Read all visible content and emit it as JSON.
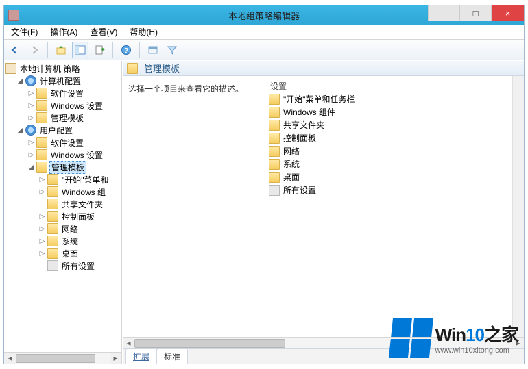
{
  "window": {
    "title": "本地组策略编辑器",
    "minimize": "–",
    "maximize": "□",
    "close": "×"
  },
  "menu": {
    "file": "文件(F)",
    "action": "操作(A)",
    "view": "查看(V)",
    "help": "帮助(H)"
  },
  "tree": {
    "root": "本地计算机 策略",
    "computer_config": "计算机配置",
    "cc_software": "软件设置",
    "cc_windows": "Windows 设置",
    "cc_admin": "管理模板",
    "user_config": "用户配置",
    "uc_software": "软件设置",
    "uc_windows": "Windows 设置",
    "uc_admin": "管理模板",
    "start_menu": "\"开始\"菜单和",
    "win_comp": "Windows 组",
    "shared": "共享文件夹",
    "control_panel": "控制面板",
    "network": "网络",
    "system": "系统",
    "desktop": "桌面",
    "all_settings": "所有设置"
  },
  "right": {
    "header": "管理模板",
    "desc": "选择一个项目来查看它的描述。",
    "col_setting": "设置",
    "items": {
      "start_menu": "\"开始\"菜单和任务栏",
      "win_comp": "Windows 组件",
      "shared": "共享文件夹",
      "control_panel": "控制面板",
      "network": "网络",
      "system": "系统",
      "desktop": "桌面",
      "all_settings": "所有设置"
    },
    "tab_ext": "扩展",
    "tab_std": "标准"
  },
  "watermark": {
    "brand_a": "Win",
    "brand_b": "10",
    "brand_c": "之家",
    "url": "www.win10xitong.com"
  }
}
